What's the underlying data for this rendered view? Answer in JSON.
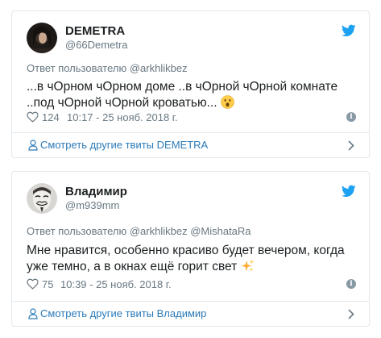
{
  "tweets": [
    {
      "author_name": "DEMETRA",
      "handle": "@66Demetra",
      "reply_prefix": "Ответ пользователю",
      "reply_mentions": "@arkhlikbez",
      "text": "...в чОрном чОрном доме ..в чОрной чОрной комнате ..под чОрной чОрной кроватью...",
      "emoji": "😮",
      "likes": "124",
      "timestamp": "10:17 - 25 нояб. 2018 г.",
      "footer_link": "Смотреть другие твиты DEMETRA"
    },
    {
      "author_name": "Владимир",
      "handle": "@m939mm",
      "reply_prefix": "Ответ пользователю",
      "reply_mentions": "@arkhlikbez @MishataRa",
      "text": "Мне нравится, особенно красиво будет вечером, когда уже темно, а в окнах ещё горит свет",
      "emoji": "✨",
      "likes": "75",
      "timestamp": "10:39 - 25 нояб. 2018 г.",
      "footer_link": "Смотреть другие твиты Владимир"
    }
  ],
  "icons": {
    "brand": "twitter-bird-icon",
    "like": "heart-icon",
    "info": "info-icon",
    "profile": "person-icon",
    "more": "chevron-right-icon"
  },
  "colors": {
    "twitter_blue": "#1da1f2",
    "link_blue": "#2b7bb9",
    "secondary_text": "#697882",
    "border": "#e1e8ed"
  }
}
